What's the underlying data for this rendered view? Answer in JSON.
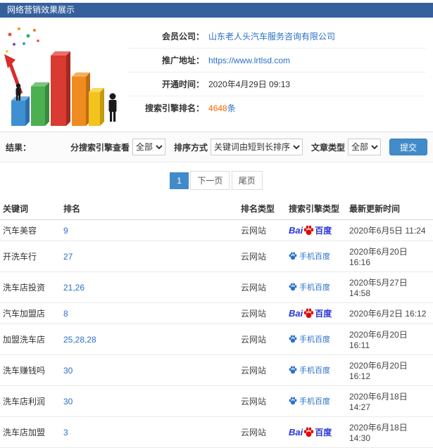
{
  "header": {
    "title": "网络营销效果展示"
  },
  "info": {
    "rows": [
      {
        "label": "会员公司：",
        "value": "山东老人头汽车服务咨询有限公司",
        "type": "link"
      },
      {
        "label": "推广地址：",
        "value": "https://www.lrtlsd.com",
        "type": "link"
      },
      {
        "label": "开通时间：",
        "value": "2020年4月29日 09:13",
        "type": "text"
      },
      {
        "label": "搜索引擎排名：",
        "value": "4648",
        "suffix": "条",
        "type": "highlight"
      }
    ]
  },
  "filters": {
    "section_label": "结果：",
    "engine_label": "分搜索引擎查看",
    "engine_value": "全部",
    "sort_label": "排序方式",
    "sort_value": "关键词由短到长排序",
    "article_label": "文章类型",
    "article_value": "全部",
    "submit_label": "提交"
  },
  "pagination": {
    "current": "1",
    "next": "下一页",
    "last": "尾页"
  },
  "table": {
    "headers": [
      "关键词",
      "排名",
      "排名类型",
      "搜索引擎类型",
      "最新更新时间"
    ],
    "engine_labels": {
      "baidu_latin": "Bai",
      "baidu_cn": "百度",
      "mobile_label": "手机百度"
    },
    "rows": [
      {
        "keyword": "汽车美容",
        "rank": "9",
        "rank_type": "云网站",
        "engine": "baidu",
        "time": "2020年6月5日 11:24"
      },
      {
        "keyword": "开洗车行",
        "rank": "27",
        "rank_type": "云网站",
        "engine": "mobile",
        "time": "2020年6月20日 16:16"
      },
      {
        "keyword": "洗车店投资",
        "rank": "21,26",
        "rank_type": "云网站",
        "engine": "mobile",
        "time": "2020年5月27日 14:58"
      },
      {
        "keyword": "汽车加盟店",
        "rank": "8",
        "rank_type": "云网站",
        "engine": "baidu",
        "time": "2020年6月2日 16:12"
      },
      {
        "keyword": "加盟洗车店",
        "rank": "25,28,28",
        "rank_type": "云网站",
        "engine": "mobile",
        "time": "2020年6月20日 16:11"
      },
      {
        "keyword": "洗车赚钱吗",
        "rank": "30",
        "rank_type": "云网站",
        "engine": "mobile",
        "time": "2020年6月20日 16:12"
      },
      {
        "keyword": "洗车店利润",
        "rank": "30",
        "rank_type": "云网站",
        "engine": "mobile",
        "time": "2020年6月18日 14:27"
      },
      {
        "keyword": "洗车店加盟",
        "rank": "3",
        "rank_type": "云网站",
        "engine": "baidu",
        "time": "2020年6月18日 14:30"
      }
    ]
  },
  "colors": {
    "header_bar": "#35609c",
    "link_blue": "#2a6fc9",
    "highlight_orange": "#ff6600",
    "submit_blue": "#428bca",
    "baidu_blue": "#2534dc",
    "baidu_red": "#e10602"
  }
}
